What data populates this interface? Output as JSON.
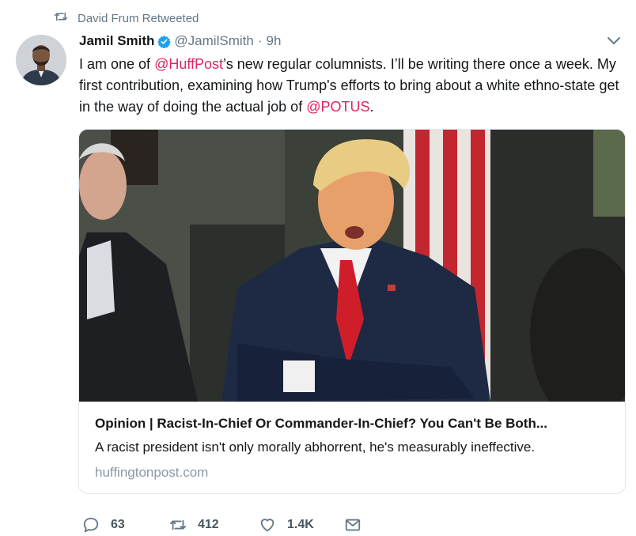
{
  "retweet_context": {
    "icon": "retweet-icon",
    "text": "David Frum Retweeted"
  },
  "author": {
    "name": "Jamil Smith",
    "handle": "@JamilSmith",
    "separator": "·",
    "time": "9h",
    "verified_icon": "verified-badge-icon"
  },
  "tweet": {
    "parts": [
      "I am one of ",
      "@HuffPost",
      "’s new regular columnists. I’ll be writing there once a week. My first contribution, examining how Trump's efforts to bring about a white ethno-state get in the way of doing the actual job of ",
      "@POTUS",
      "."
    ]
  },
  "card": {
    "title": "Opinion | Racist-In-Chief Or Commander-In-Chief? You Can't Be Both...",
    "description": "A racist president isn't only morally abhorrent, he's measurably ineffective.",
    "domain": "huffingtonpost.com"
  },
  "actions": {
    "reply": {
      "icon": "reply-icon",
      "count": "63"
    },
    "retweet": {
      "icon": "retweet-icon",
      "count": "412"
    },
    "like": {
      "icon": "heart-icon",
      "count": "1.4K"
    },
    "dm": {
      "icon": "envelope-icon"
    }
  },
  "colors": {
    "mention": "#e0245e",
    "secondary": "#657786",
    "verified": "#1da1f2"
  }
}
